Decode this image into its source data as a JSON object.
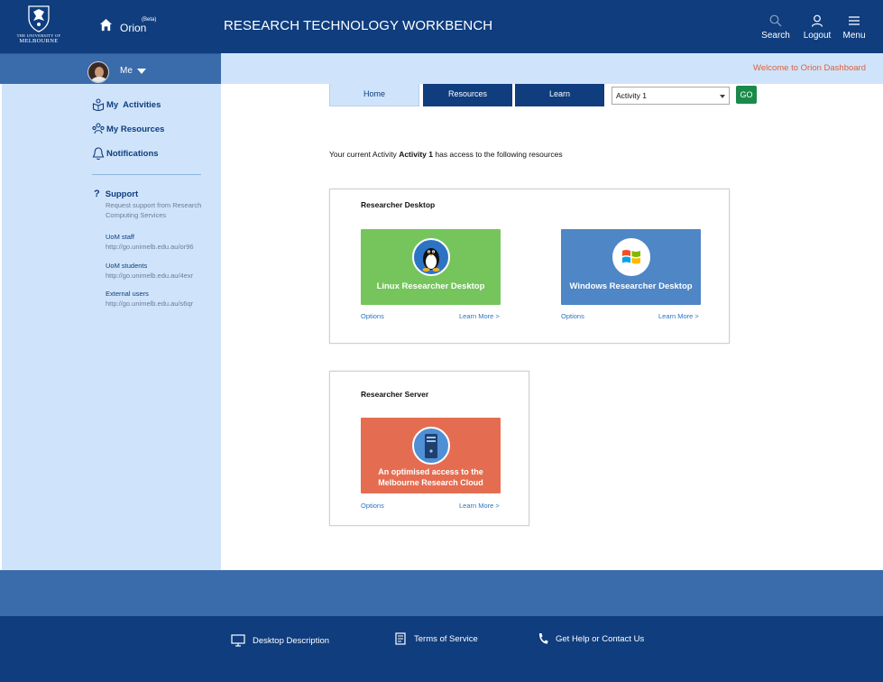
{
  "header": {
    "logo_line1": "THE UNIVERSITY OF",
    "logo_line2": "MELBOURNE",
    "brand_name": "Orion",
    "brand_tag": "(Beta)",
    "title": "RESEARCH TECHNOLOGY WORKBENCH",
    "search_label": "Search",
    "logout_label": "Logout",
    "menu_label": "Menu"
  },
  "user": {
    "name": "Me"
  },
  "welcome": "Welcome to Orion Dashboard",
  "sidebar": {
    "items": [
      {
        "label": "My  Activities",
        "icon": "activities-icon"
      },
      {
        "label": "My Resources",
        "icon": "resources-icon"
      },
      {
        "label": "Notifications",
        "icon": "bell-icon"
      }
    ],
    "support": {
      "title": "Support",
      "desc": "Request support from Research Computing Services",
      "links": [
        {
          "label": "UoM staff",
          "url": "http://go.unimelb.edu.au/or96"
        },
        {
          "label": "UoM students",
          "url": "http://go.unimelb.edu.au/4exr"
        },
        {
          "label": "External users",
          "url": "http://go.unimelb.edu.au/s6qr"
        }
      ]
    }
  },
  "tabs": [
    {
      "label": "Home",
      "active": true
    },
    {
      "label": "Resources",
      "active": false
    },
    {
      "label": "Learn",
      "active": false
    }
  ],
  "activity_select": {
    "value": "Activity 1",
    "go_label": "GO"
  },
  "activity_line": {
    "prefix": "Your current Activity",
    "name": "Activity 1",
    "suffix": "has access to the following resources"
  },
  "panels": {
    "desktop": {
      "title": "Researcher Desktop",
      "tiles": [
        {
          "label": "Linux Researcher Desktop",
          "options": "Options",
          "learn": "Learn More >"
        },
        {
          "label": "Windows Researcher Desktop",
          "options": "Options",
          "learn": "Learn More >"
        }
      ]
    },
    "server": {
      "title": "Researcher Server",
      "tile": {
        "line1": "An optimised access to the",
        "line2": "Melbourne Research Cloud",
        "options": "Options",
        "learn": "Learn More >"
      }
    }
  },
  "footer": {
    "items": [
      {
        "label": "Desktop Description",
        "icon": "monitor-icon"
      },
      {
        "label": "Terms of Service",
        "icon": "document-icon"
      },
      {
        "label": "Get Help or Contact Us",
        "icon": "phone-icon"
      }
    ]
  },
  "colors": {
    "header_blue": "#0f3d7e",
    "mid_blue": "#3a6bab",
    "light_blue": "#cfe4fb",
    "accent_orange": "#e0603b",
    "linux_green": "#75c55c",
    "windows_blue": "#4f86c6",
    "server_orange": "#e46d51",
    "go_green": "#1a8a4a"
  }
}
